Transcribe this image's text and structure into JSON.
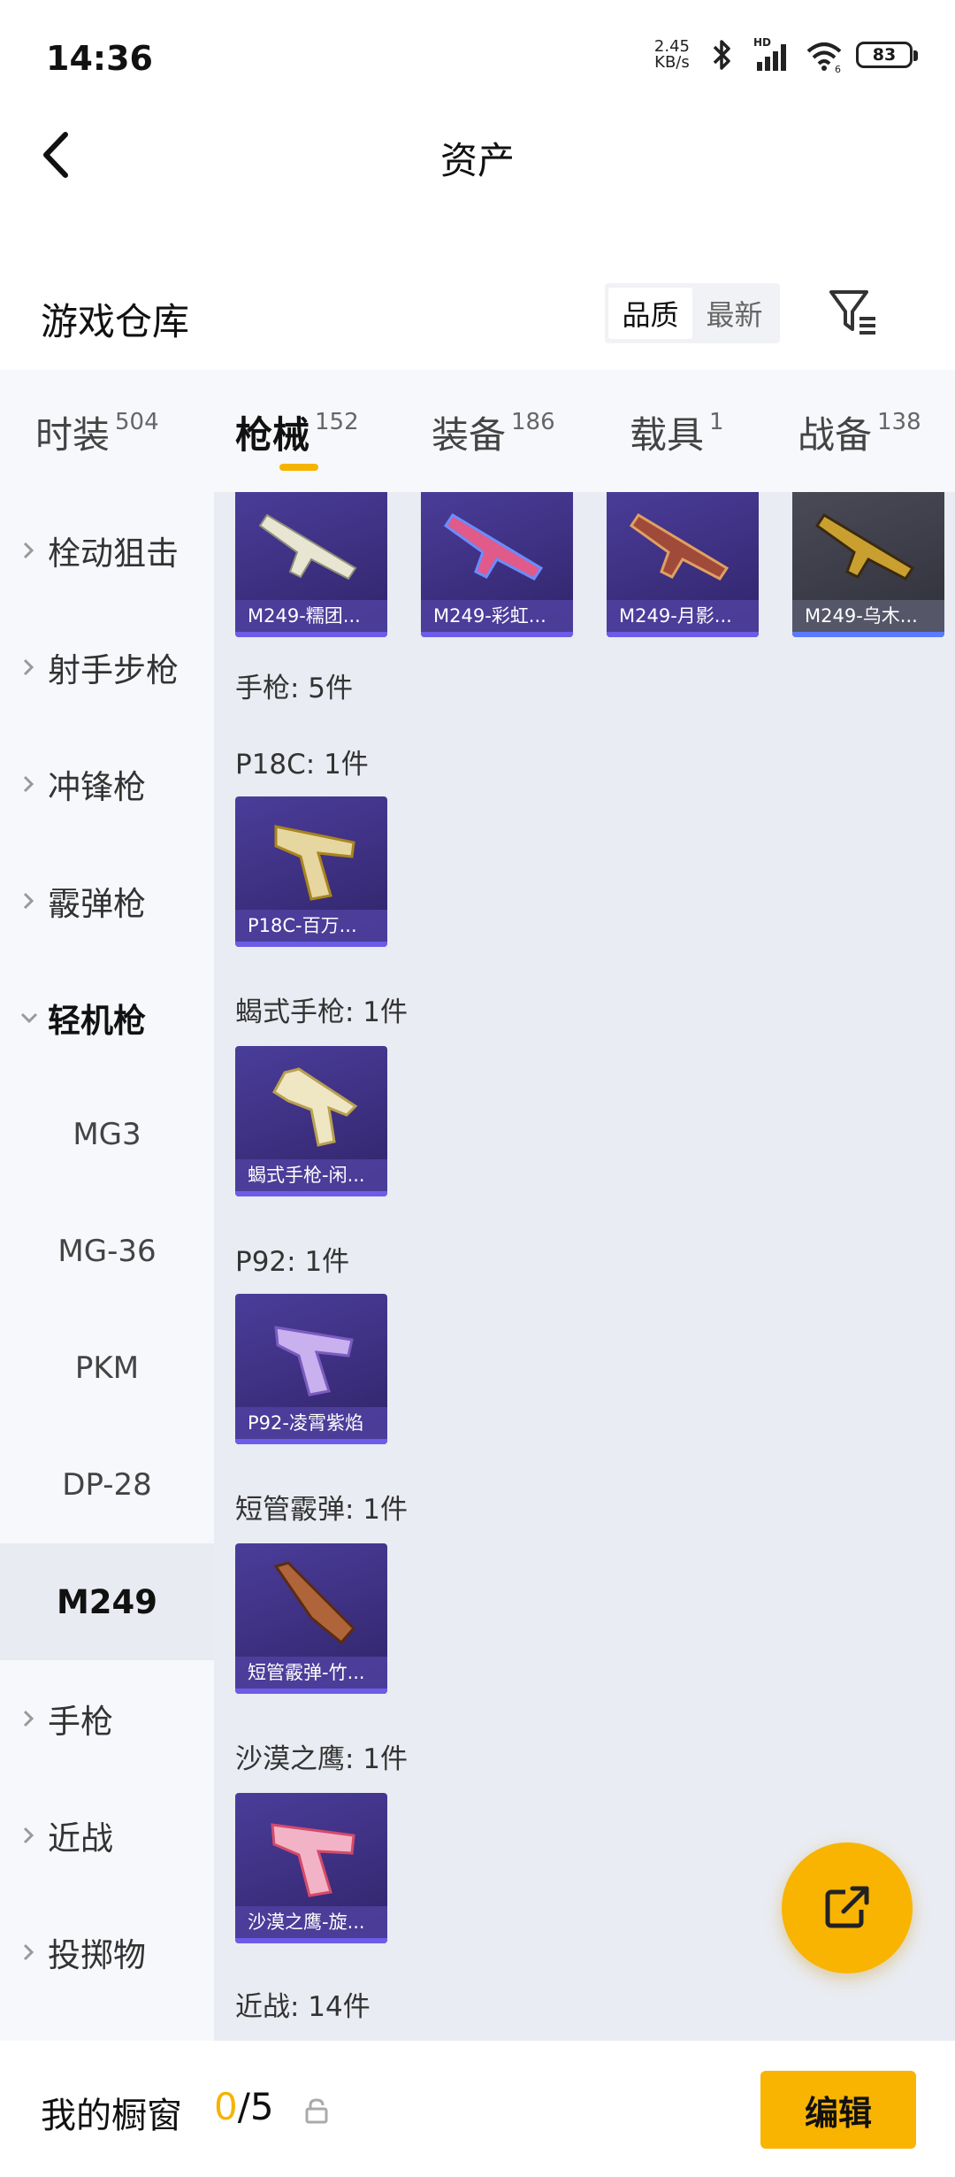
{
  "status_bar": {
    "time": "14:36",
    "net_speed_value": "2.45",
    "net_speed_unit": "KB/s",
    "signal_badge": "HD",
    "wifi_badge": "6",
    "battery": "83"
  },
  "header": {
    "title": "资产"
  },
  "warehouse": {
    "title": "游戏仓库",
    "sort_options": [
      "品质",
      "最新"
    ],
    "sort_selected": "品质"
  },
  "tabs": [
    {
      "label": "时装",
      "count": "504"
    },
    {
      "label": "枪械",
      "count": "152",
      "active": true
    },
    {
      "label": "装备",
      "count": "186"
    },
    {
      "label": "载具",
      "count": "1"
    },
    {
      "label": "战备",
      "count": "138"
    }
  ],
  "sidebar": {
    "items": [
      {
        "label": "栓动狙击"
      },
      {
        "label": "射手步枪"
      },
      {
        "label": "冲锋枪"
      },
      {
        "label": "霰弹枪"
      },
      {
        "label": "轻机枪",
        "expanded": true
      },
      {
        "label": "MG3",
        "sub": true
      },
      {
        "label": "MG-36",
        "sub": true
      },
      {
        "label": "PKM",
        "sub": true
      },
      {
        "label": "DP-28",
        "sub": true
      },
      {
        "label": "M249",
        "sub": true,
        "selected": true
      },
      {
        "label": "手枪"
      },
      {
        "label": "近战"
      },
      {
        "label": "投掷物"
      }
    ]
  },
  "content": {
    "top_cards": [
      {
        "name": "M249-糯团...",
        "icon": "machine-gun-skin"
      },
      {
        "name": "M249-彩虹...",
        "icon": "machine-gun-skin"
      },
      {
        "name": "M249-月影...",
        "icon": "machine-gun-skin"
      },
      {
        "name": "M249-乌木...",
        "icon": "machine-gun-skin"
      }
    ],
    "pistol_group_label": "手枪: 5件",
    "groups": [
      {
        "label": "P18C: 1件",
        "card": "P18C-百万..."
      },
      {
        "label": "蝎式手枪: 1件",
        "card": "蝎式手枪-闲..."
      },
      {
        "label": "P92: 1件",
        "card": "P92-凌霄紫焰"
      },
      {
        "label": "短管霰弹: 1件",
        "card": "短管霰弹-竹..."
      },
      {
        "label": "沙漠之鹰: 1件",
        "card": "沙漠之鹰-旋..."
      }
    ],
    "melee_group_label": "近战: 14件"
  },
  "showcase": {
    "label": "我的橱窗",
    "current": "0",
    "total": "/5",
    "edit_label": "编辑"
  },
  "colors": {
    "accent": "#f8b400",
    "card_purple": "#3d2f7f",
    "card_grey": "#3a3b46",
    "content_bg": "#e9ecf2",
    "sidebar_bg": "#f6f8fb"
  }
}
